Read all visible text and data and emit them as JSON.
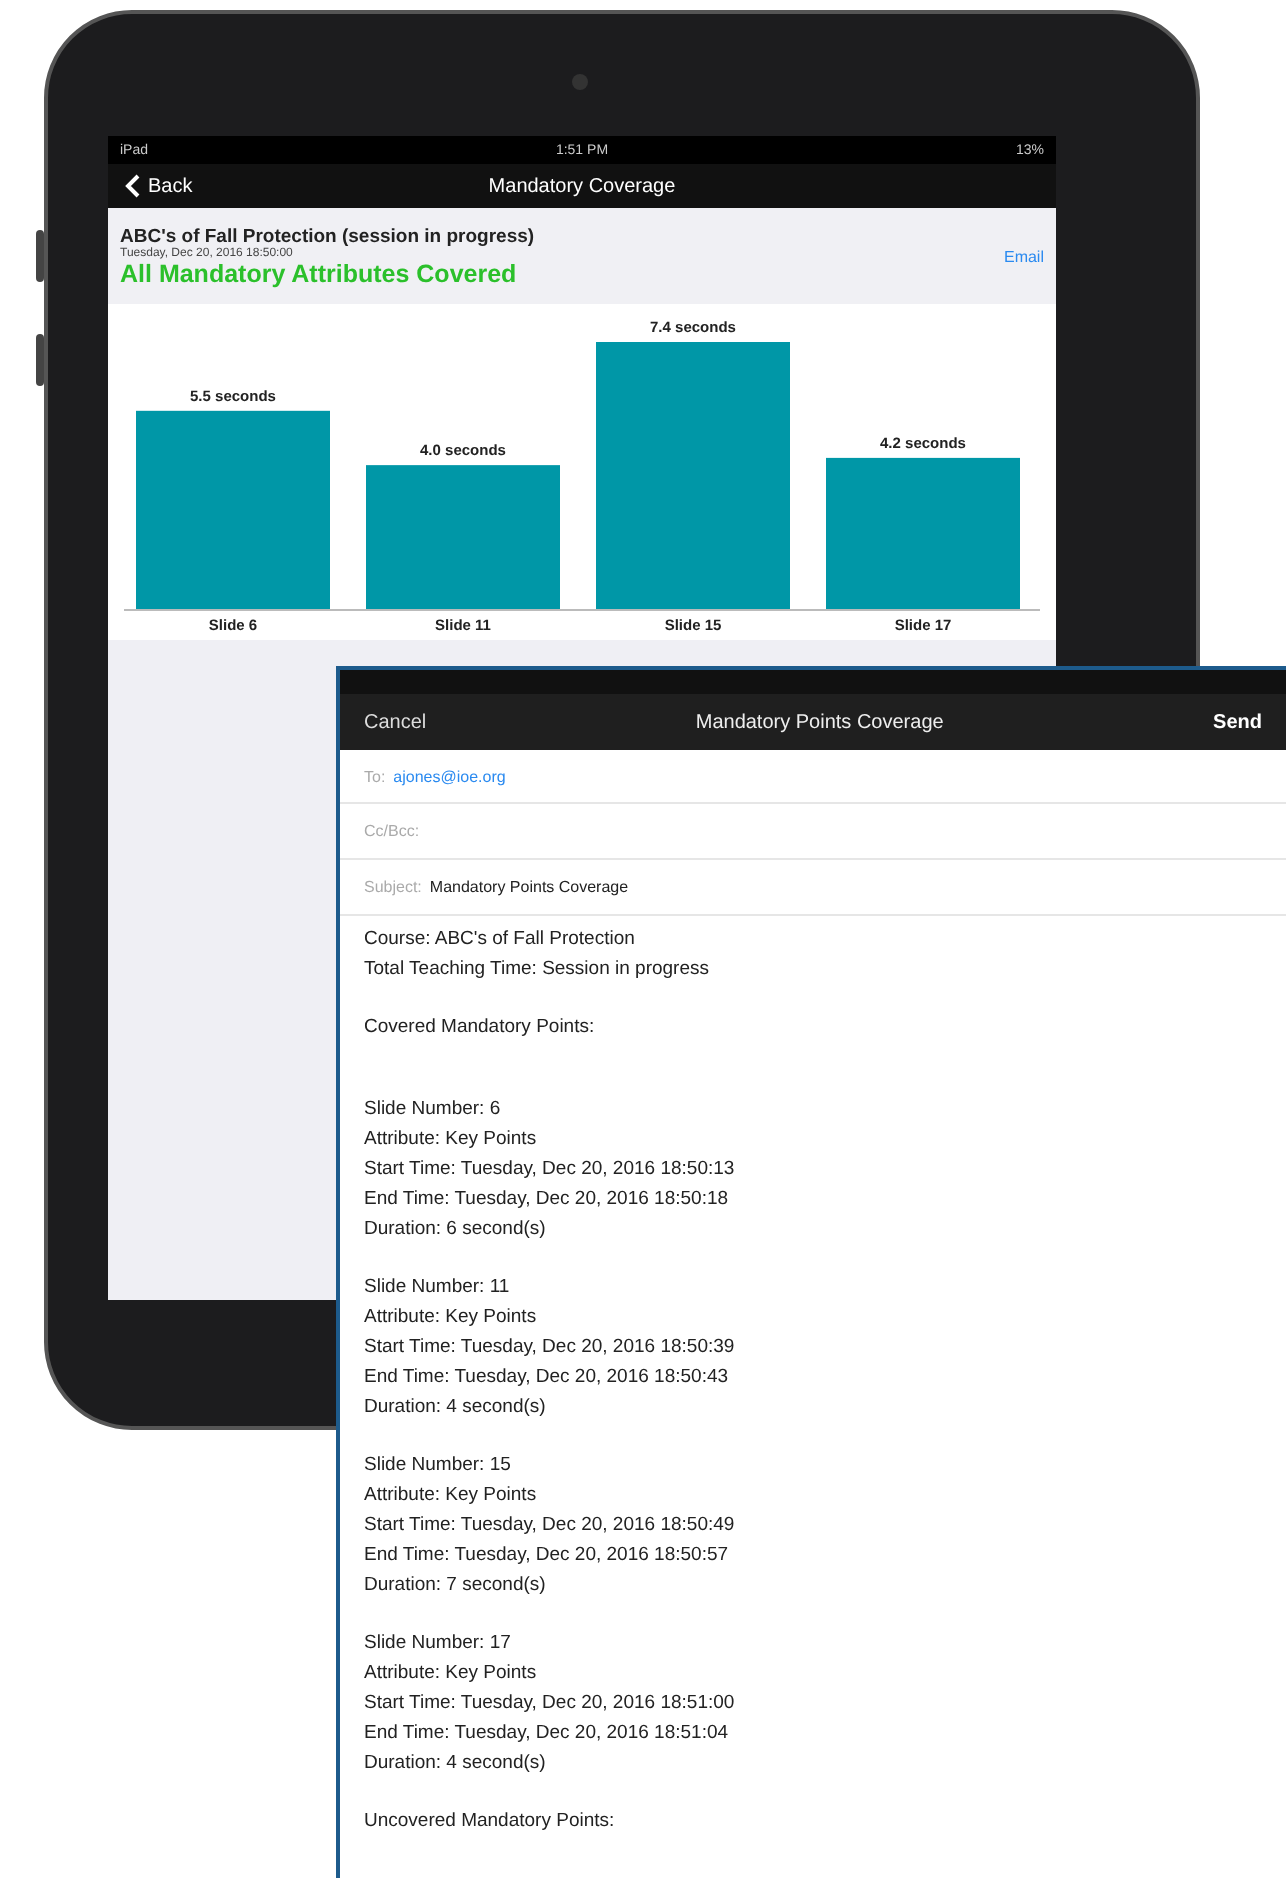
{
  "status_bar": {
    "device": "iPad",
    "time": "1:51 PM",
    "battery": "13%"
  },
  "nav_bar": {
    "back": "Back",
    "title": "Mandatory Coverage"
  },
  "session": {
    "title": "ABC's of Fall Protection (session in progress)",
    "date": "Tuesday, Dec 20, 2016 18:50:00",
    "status": "All Mandatory Attributes Covered",
    "email": "Email"
  },
  "chart": {
    "chart_data": {
      "type": "bar",
      "categories": [
        "Slide 6",
        "Slide 11",
        "Slide 15",
        "Slide 17"
      ],
      "values": [
        5.5,
        4.0,
        7.4,
        4.2
      ],
      "data_labels": true,
      "value_labels": [
        "5.5 seconds",
        "4.0 seconds",
        "7.4 seconds",
        "4.2 seconds"
      ]
    }
  },
  "email": {
    "cancel": "Cancel",
    "title": "Mandatory Points Coverage",
    "send": "Send",
    "fields": [
      {
        "label": "To:",
        "value": "ajones@ioe.org",
        "kind": "recipient"
      },
      {
        "label": "Cc/Bcc:",
        "kind": "plain"
      },
      {
        "label": "Subject:",
        "value": "Mandatory Points Coverage",
        "kind": "plain"
      }
    ],
    "paragraphs": [
      [
        "Course: ABC's of Fall Protection",
        "Total Teaching Time: Session in progress"
      ],
      [
        "Covered Mandatory Points:"
      ],
      [
        "Slide Number: 6",
        "Attribute: Key Points",
        "Start Time: Tuesday, Dec 20, 2016 18:50:13",
        "End Time: Tuesday, Dec 20, 2016 18:50:18",
        "Duration: 6 second(s)"
      ],
      [
        "Slide Number: 11",
        "Attribute: Key Points",
        "Start Time: Tuesday, Dec 20, 2016 18:50:39",
        "End Time: Tuesday, Dec 20, 2016 18:50:43",
        "Duration: 4 second(s)"
      ],
      [
        "Slide Number: 15",
        "Attribute: Key Points",
        "Start Time: Tuesday, Dec 20, 2016 18:50:49",
        "End Time: Tuesday, Dec 20, 2016 18:50:57",
        "Duration: 7 second(s)"
      ],
      [
        "Slide Number: 17",
        "Attribute: Key Points",
        "Start Time: Tuesday, Dec 20, 2016 18:51:00",
        "End Time: Tuesday, Dec 20, 2016 18:51:04",
        "Duration: 4 second(s)"
      ],
      [
        "Uncovered Mandatory Points:"
      ]
    ]
  }
}
